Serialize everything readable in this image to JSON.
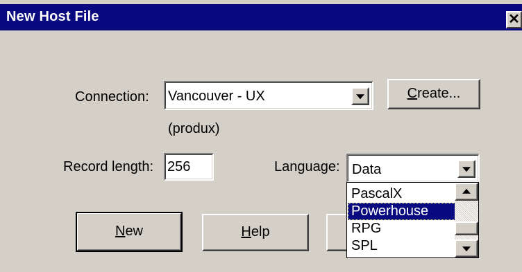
{
  "window": {
    "title": "New Host File",
    "close_label": "✕"
  },
  "connection": {
    "label": "Connection:",
    "value": "Vancouver - UX",
    "host_note": "(produx)",
    "create_button_prefix": "",
    "create_button_accel": "C",
    "create_button_rest": "reate..."
  },
  "record_length": {
    "label": "Record length:",
    "value": "256"
  },
  "language": {
    "label": "Language:",
    "value": "Data",
    "options_visible": [
      "PascalX",
      "Powerhouse",
      "RPG",
      "SPL"
    ],
    "selected_option": "Powerhouse"
  },
  "buttons": {
    "new_accel": "N",
    "new_rest": "ew",
    "help_accel": "H",
    "help_rest": "elp"
  },
  "colors": {
    "titlebar": "#0a0a80",
    "dialog_face": "#d4d0c8",
    "selection": "#0a0a80"
  }
}
